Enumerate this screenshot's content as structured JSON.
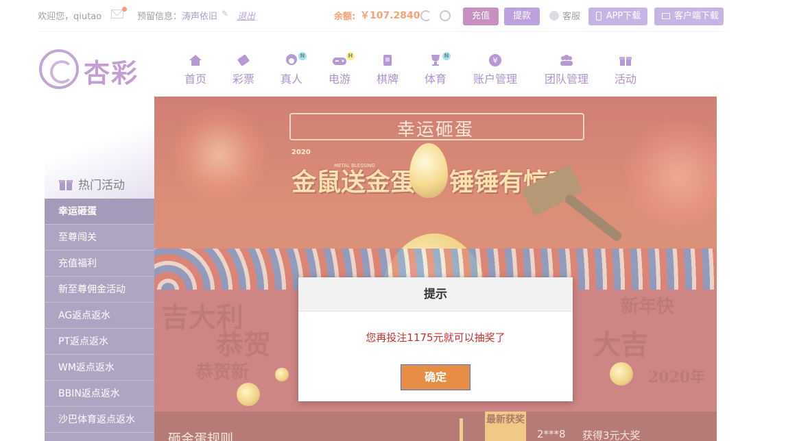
{
  "topbar": {
    "welcome": "欢迎您，qiutao",
    "reserved_label": "预留信息：",
    "reserved_value": "涛声依旧",
    "logout": "退出",
    "balance_label": "余额:",
    "balance_value": "￥107.2840",
    "recharge": "充值",
    "withdraw": "提款",
    "customer_service": "客服",
    "app_download": "APP下载",
    "client_download": "客户端下载"
  },
  "logo": {
    "text": "杏彩"
  },
  "nav": {
    "items": [
      {
        "label": "首页",
        "icon": "home-icon"
      },
      {
        "label": "彩票",
        "icon": "ticket-icon"
      },
      {
        "label": "真人",
        "icon": "live-dealer-icon",
        "badge": "N"
      },
      {
        "label": "电游",
        "icon": "gamepad-icon",
        "badge": "H"
      },
      {
        "label": "棋牌",
        "icon": "cards-icon"
      },
      {
        "label": "体育",
        "icon": "trophy-icon",
        "badge": "N"
      },
      {
        "label": "账户管理",
        "icon": "yen-coin-icon"
      },
      {
        "label": "团队管理",
        "icon": "team-icon"
      },
      {
        "label": "活动",
        "icon": "gift-icon"
      }
    ]
  },
  "sidebar": {
    "title": "热门活动",
    "items": [
      {
        "label": "幸运砸蛋"
      },
      {
        "label": "至尊闯关"
      },
      {
        "label": "充值福利"
      },
      {
        "label": "新至尊佣金活动"
      },
      {
        "label": "AG返点返水"
      },
      {
        "label": "PT返点返水"
      },
      {
        "label": "WM返点返水"
      },
      {
        "label": "BBIN返点返水"
      },
      {
        "label": "沙巴体育返点返水"
      }
    ]
  },
  "banner": {
    "title": "幸运砸蛋",
    "slogan_left": "金鼠送金蛋",
    "slogan_right": "锤锤有惊喜",
    "tag_year": "2020",
    "tag_en": "METAL BLESSING"
  },
  "bottom": {
    "rules_title": "砸金蛋规则",
    "ribbon": "最新获奖",
    "winner_name": "2***8",
    "winner_prize": "获得3元大奖"
  },
  "modal": {
    "title": "提示",
    "message": "您再投注1175元就可以抽奖了",
    "confirm": "确定"
  },
  "colors": {
    "brand_purple": "#7b4fb2",
    "sidebar_bg": "#7d6e9f",
    "balance": "#f06a1a",
    "modal_message": "#c6302a",
    "confirm_button": "#e88d45"
  }
}
